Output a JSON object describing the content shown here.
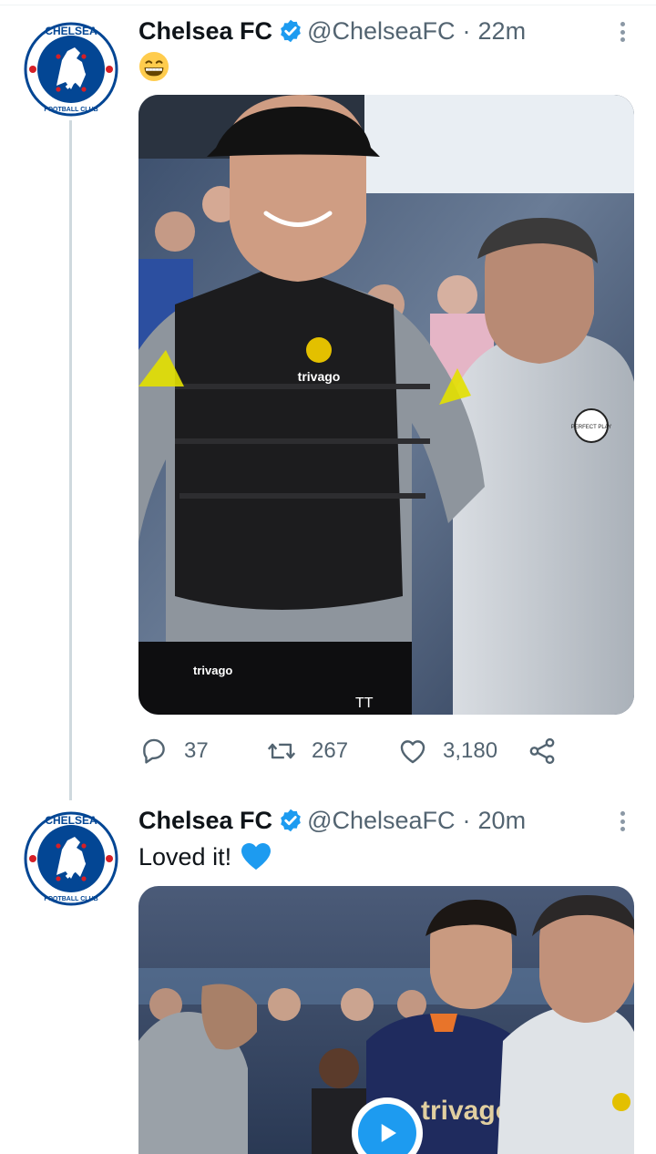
{
  "tweets": [
    {
      "author_name": "Chelsea FC",
      "handle": "@ChelseaFC",
      "separator": "·",
      "time": "22m",
      "text": "",
      "text_emoji": "grinning-face",
      "media_type": "photo",
      "stats": {
        "replies": "37",
        "retweets": "267",
        "likes": "3,180"
      }
    },
    {
      "author_name": "Chelsea FC",
      "handle": "@ChelseaFC",
      "separator": "·",
      "time": "20m",
      "text": "Loved it!",
      "text_emoji": "blue-heart",
      "media_type": "video"
    }
  ],
  "colors": {
    "verified": "#1d9bf0",
    "secondary_text": "#536471",
    "thread_line": "#cfd9de",
    "chelsea_blue": "#034694",
    "play_button": "#1d9bf0"
  },
  "icons": [
    "verified-badge-icon",
    "more-icon",
    "reply-icon",
    "retweet-icon",
    "like-icon",
    "share-icon",
    "play-icon"
  ],
  "badge_text": {
    "crest_top": "CHELSEA",
    "crest_bottom": "FOOTBALL CLUB",
    "sponsor": "trivago",
    "sleeve_badge": "PERFECT PLAY",
    "initials": "TT"
  }
}
